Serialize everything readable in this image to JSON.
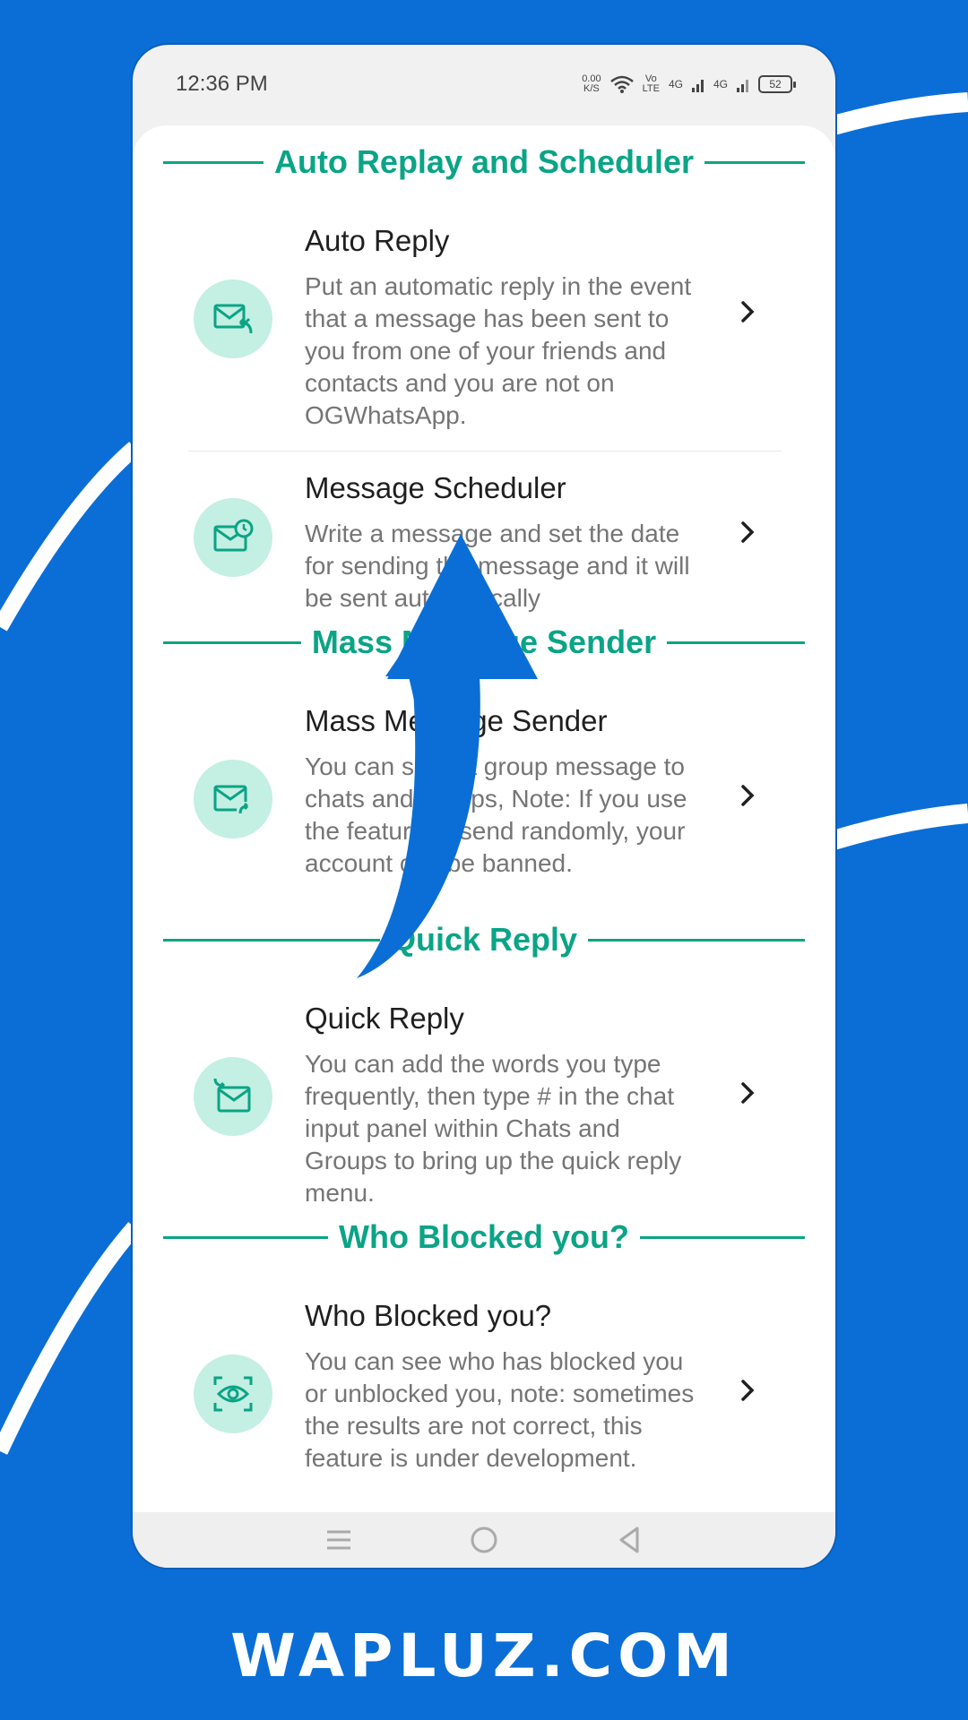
{
  "status_bar": {
    "time": "12:36 PM",
    "net_speed_value": "0.00",
    "net_speed_unit": "K/S",
    "volte": "Vo",
    "volte_sub": "LTE",
    "sim1": "4G",
    "sim2": "4G",
    "battery": "52"
  },
  "sections": [
    {
      "title": "Auto Replay and Scheduler",
      "items": [
        {
          "title": "Auto Reply",
          "description": "Put an automatic reply in the event that a message has been sent to you from one of your friends and contacts and you are not on OGWhatsApp.",
          "icon": "mail-reply-icon"
        },
        {
          "title": "Message Scheduler",
          "description": "Write a message and set the date for sending the message and it will be sent automatically",
          "icon": "mail-clock-icon"
        }
      ]
    },
    {
      "title": "Mass Message Sender",
      "items": [
        {
          "title": "Mass Message Sender",
          "description": "You can send a group message to chats and groups, Note: If you use the feature to send randomly, your account can be banned.",
          "icon": "mail-forward-icon"
        }
      ]
    },
    {
      "title": "Quick Reply",
      "items": [
        {
          "title": "Quick Reply",
          "description": "You can add the words you type frequently, then type # in the chat input panel within Chats and Groups to bring up the quick reply menu.",
          "icon": "mail-quick-icon"
        }
      ]
    },
    {
      "title": "Who Blocked you?",
      "items": [
        {
          "title": "Who Blocked you?",
          "description": "You can see who has blocked you or unblocked you, note: sometimes the results are not correct, this feature is under development.",
          "icon": "eye-scan-icon"
        }
      ]
    }
  ],
  "nav_bar": {
    "menu": "menu-icon",
    "home": "home-icon",
    "back": "back-icon"
  },
  "watermark": "WAPLUZ.COM",
  "colors": {
    "background": "#0a6ed6",
    "accent": "#0aa486",
    "icon_bg": "#c4efe3",
    "arrow": "#0a6ed6"
  }
}
